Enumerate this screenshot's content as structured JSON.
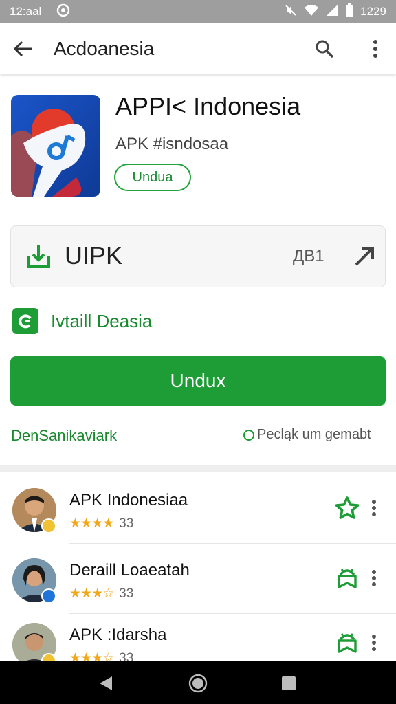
{
  "status_bar": {
    "time_left": "12:aal",
    "time_right": "1229"
  },
  "app_bar": {
    "title": "Acdoanesia"
  },
  "app": {
    "name": "APPI< Indonesia",
    "subtitle": "APK #isndosaa",
    "chip_label": "Undua"
  },
  "download_card": {
    "label": "UIPK",
    "size": "ДB1"
  },
  "verified": {
    "text": "Ivtaill Deasia"
  },
  "download_button": {
    "label": "Undux"
  },
  "footer": {
    "left_text": "DenSanikaviark",
    "right_text": "Pecląk um gemabt"
  },
  "related": [
    {
      "name": "APK Indonesiaa",
      "stars": "★★★★",
      "count": "33",
      "badge_color": "#f1c232",
      "action_icon": "star-outline-icon"
    },
    {
      "name": "Deraill Loaeatah",
      "stars": "★★★☆",
      "count": "33",
      "badge_color": "#1e74d8",
      "action_icon": "android-outline-icon"
    },
    {
      "name": "APK :Idarsha",
      "stars": "★★★☆",
      "count": "33",
      "badge_color": "#f1c232",
      "action_icon": "android-outline-icon"
    }
  ],
  "colors": {
    "accent": "#1e9c35",
    "status_bar": "#9e9e9e",
    "star": "#f0a81a"
  }
}
